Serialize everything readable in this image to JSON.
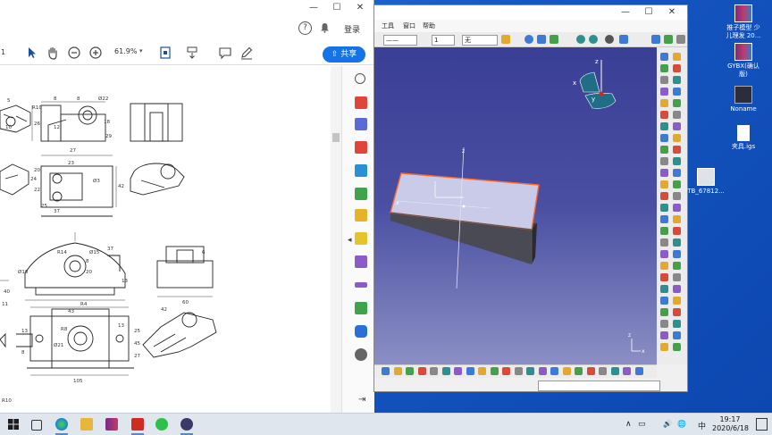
{
  "pdf_window": {
    "help_glyph": "?",
    "login": "登录",
    "share": "共享",
    "share_glyph": "⇧",
    "zoom": "61.9%",
    "page_number": "1",
    "caret": "▾",
    "glyphs": {
      "min": "—",
      "max": "☐",
      "close": "✕"
    },
    "tool_icons": [
      "select-arrow-icon",
      "hand-icon",
      "zoom-out-icon",
      "zoom-in-icon",
      "fit-page-icon",
      "scroll-mode-icon",
      "comment-icon",
      "pen-icon"
    ],
    "right_panel_icons": [
      "search-icon",
      "export-pdf-icon",
      "combine-icon",
      "organize-icon",
      "share-export-icon",
      "create-pdf-icon",
      "edit-pdf-icon",
      "comment-icon",
      "fill-sign-icon",
      "measure-icon",
      "print-icon",
      "protect-icon",
      "tools-icon"
    ],
    "drawing_dimensions": [
      "5",
      "10",
      "R10",
      "Ø22",
      "8",
      "8",
      "26",
      "12",
      "18",
      "29",
      "27",
      "23",
      "24",
      "42",
      "20",
      "37",
      "22",
      "25",
      "Ø3",
      "R4",
      "Ø10",
      "37",
      "13",
      "8",
      "20",
      "Ø15",
      "R14",
      "42",
      "6",
      "43",
      "60",
      "R8",
      "13",
      "45",
      "Ø21",
      "27",
      "25",
      "13",
      "8",
      "105",
      "40",
      "11",
      "R10"
    ]
  },
  "catia_window": {
    "menu": [
      "工具",
      "窗口",
      "帮助"
    ],
    "combo_values": [
      "1",
      "无"
    ],
    "glyphs": {
      "min": "—",
      "max": "☐",
      "close": "✕"
    },
    "compass_labels": [
      "z",
      "x",
      "y"
    ],
    "part_labels": [
      "z",
      "x"
    ],
    "corner_axes": [
      "z",
      "x"
    ]
  },
  "desktop_icons": [
    {
      "label": "推子模型 少儿理发 20...",
      "icon": "archive-icon"
    },
    {
      "label": "GYBX(确认版)",
      "icon": "archive-icon"
    },
    {
      "label": "Noname",
      "icon": "catia-file-icon"
    },
    {
      "label": "夹具.igs",
      "icon": "document-icon"
    },
    {
      "label": "TB_67812...",
      "icon": "image-file-icon"
    }
  ],
  "taskbar": {
    "time": "19:17",
    "date": "2020/6/18",
    "ime": "中",
    "tray_glyphs": [
      "∧",
      "▭",
      "🔊",
      "🌐"
    ],
    "apps": [
      "start-button",
      "task-view-icon",
      "edge-icon",
      "file-explorer-icon",
      "winrar-icon",
      "acrobat-icon",
      "wechat-icon",
      "catia-icon"
    ]
  },
  "colors": {
    "share_blue": "#1473e6",
    "desktop_blue": "#1557c2",
    "viewport_top": "#3a3f96",
    "part_face": "#c9cbe8",
    "part_edge": "#ff6a2a"
  }
}
